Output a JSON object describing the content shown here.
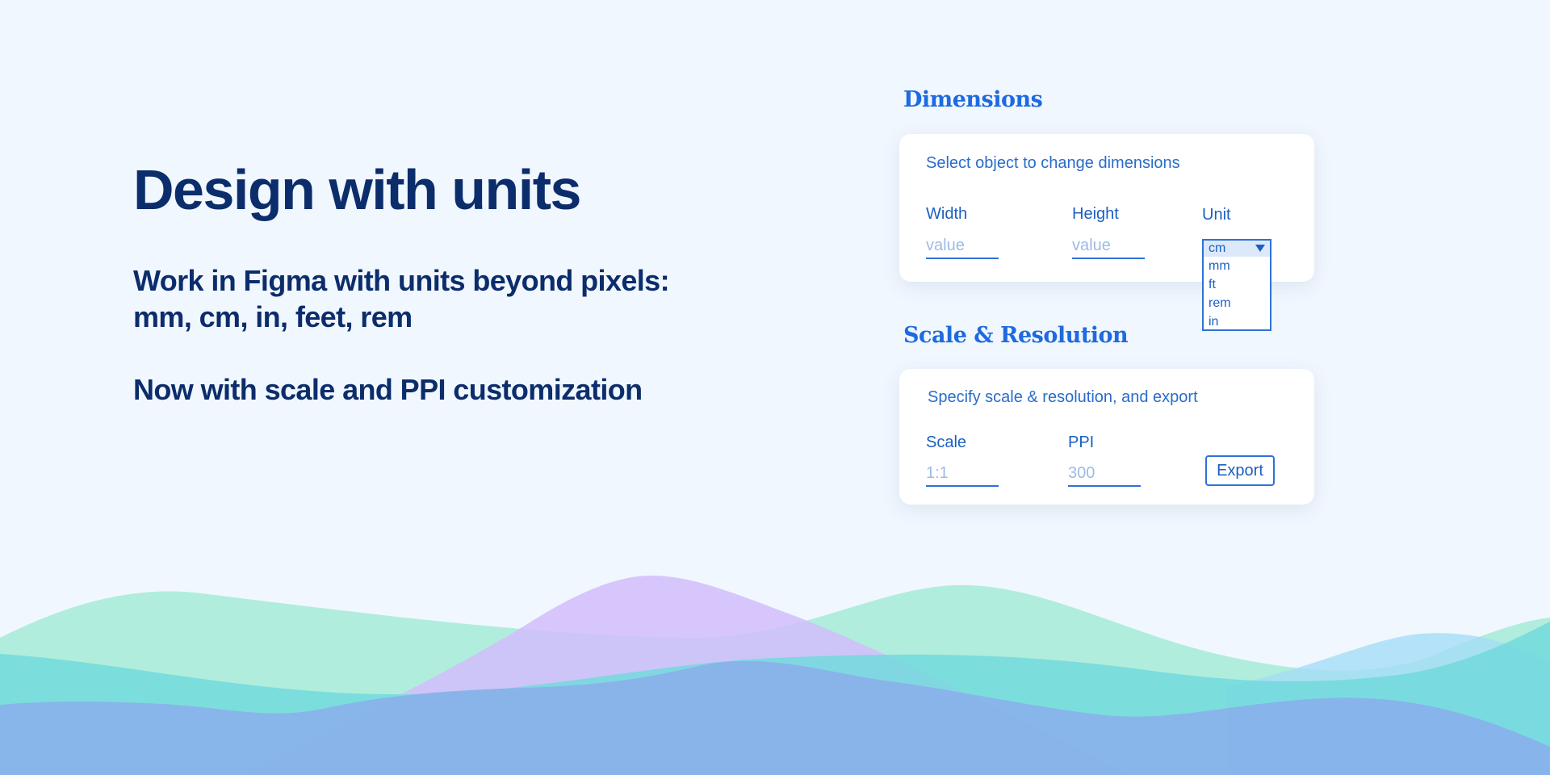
{
  "hero": {
    "title": "Design with units",
    "subtitle_line1": "Work in Figma with units beyond pixels:",
    "subtitle_line2": "mm, cm, in, feet, rem",
    "subtitle2": "Now with scale and PPI customization"
  },
  "dimensions": {
    "section_title": "Dimensions",
    "hint": "Select object to change dimensions",
    "width_label": "Width",
    "width_placeholder": "value",
    "height_label": "Height",
    "height_placeholder": "value",
    "unit_label": "Unit",
    "unit_selected": "cm",
    "unit_options": [
      "mm",
      "ft",
      "rem",
      "in"
    ]
  },
  "scale": {
    "section_title": "Scale & Resolution",
    "hint": "Specify scale & resolution, and export",
    "scale_label": "Scale",
    "scale_placeholder": "1:1",
    "ppi_label": "PPI",
    "ppi_placeholder": "300",
    "export_label": "Export"
  },
  "colors": {
    "background": "#f1f7fe",
    "accent": "#1e6ae0",
    "heading": "#0c2d6b",
    "wave_green": "#a9ebd6",
    "wave_purple": "#d7c6fb",
    "wave_teal": "#74dade",
    "wave_blue": "#89b3ea"
  }
}
